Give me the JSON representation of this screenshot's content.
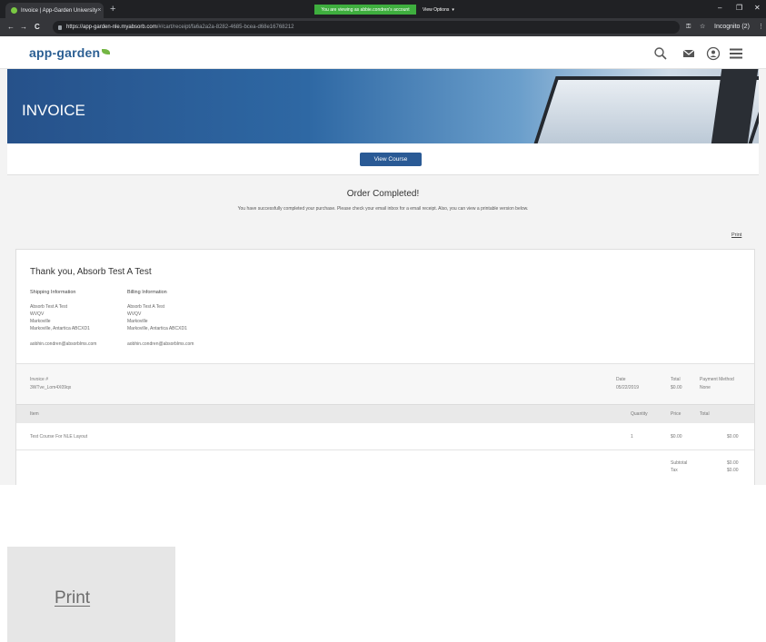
{
  "browser": {
    "tab_title": "Invoice | App-Garden University",
    "tab_close": "×",
    "new_tab": "+",
    "notice": "You are viewing as abbie.condren's account",
    "view_options": "View Options",
    "view_options_caret": "▾",
    "url_host": "https://app-garden-nle.myabsorb.com",
    "url_path": "/#/cart/receipt/fa6a2a2a-8282-4685-bcea-d68e16768212",
    "incognito": "Incognito (2)",
    "minimize": "–",
    "maximize": "❐",
    "close": "✕",
    "back": "←",
    "forward": "→",
    "reload": "C",
    "key_icon": "⚿",
    "star_icon": "☆",
    "menu_dots": "⋮"
  },
  "site": {
    "logo": "app-garden",
    "banner_title": "INVOICE",
    "view_course_button": "View Course"
  },
  "order": {
    "title": "Order Completed!",
    "message": "You have successfully completed your purchase. Please check your email inbox for a email receipt. Also, you can view a printable version below.",
    "print_link": "Print"
  },
  "receipt": {
    "thanks": "Thank you, Absorb Test A Test",
    "shipping": {
      "heading": "Shipping Information",
      "lines": [
        "Absorb Test A Test",
        "WVQV",
        "Markoville",
        "Markoville, Antartica ABCXD1"
      ],
      "email": "aobhin.condren@absorblms.com"
    },
    "billing": {
      "heading": "Billing Information",
      "lines": [
        "Absorb Test A Test",
        "WVQV",
        "Markoville",
        "Markoville, Antartica ABCXD1"
      ],
      "email": "aobhin.condren@absorblms.com"
    },
    "invoice_label": "Invoice #",
    "invoice_value": "3WTve_Lom4X09qx",
    "date_label": "Date",
    "date_value": "05/22/2019",
    "total_label": "Total",
    "total_value": "$0.00",
    "payment_label": "Payment Method",
    "payment_value": "None",
    "columns": [
      "Item",
      "Quantity",
      "Price",
      "Total"
    ],
    "rows": [
      {
        "item": "Test Course For NLE Layout",
        "quantity": "1",
        "price": "$0.00",
        "total": "$0.00"
      }
    ],
    "subtotal_label": "Subtotal",
    "subtotal_value": "$0.00",
    "tax_label": "Tax",
    "tax_value": "$0.00"
  },
  "zoom_inset": {
    "label": "Print"
  }
}
